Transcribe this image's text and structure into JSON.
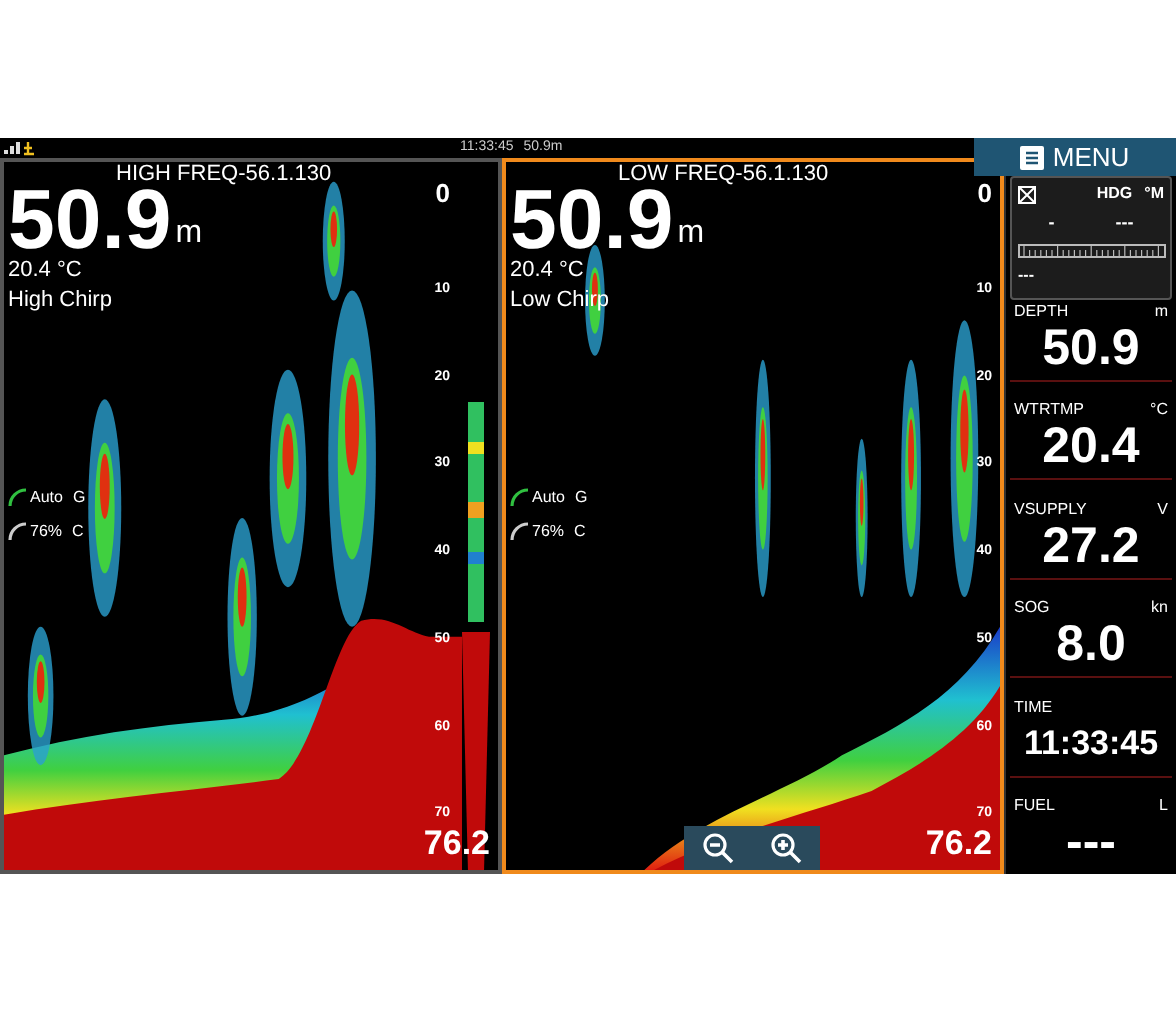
{
  "status_bar": {
    "time": "11:33:45",
    "depth": "50.9m"
  },
  "menu_button": {
    "label": "MENU"
  },
  "panels": [
    {
      "selected": false,
      "title": "HIGH FREQ-56.1.130",
      "depth": "50.9",
      "depth_unit": "m",
      "temperature": "20.4 °C",
      "mode": "High Chirp",
      "gain": {
        "value": "Auto",
        "letter": "G"
      },
      "color": {
        "value": "76%",
        "letter": "C"
      },
      "ticks": [
        "0",
        "10",
        "20",
        "30",
        "40",
        "50",
        "60",
        "70"
      ],
      "range_end": "76.2",
      "a_scope": true,
      "zoom_controls": false
    },
    {
      "selected": true,
      "title": "LOW FREQ-56.1.130",
      "depth": "50.9",
      "depth_unit": "m",
      "temperature": "20.4 °C",
      "mode": "Low Chirp",
      "gain": {
        "value": "Auto",
        "letter": "G"
      },
      "color": {
        "value": "76%",
        "letter": "C"
      },
      "ticks": [
        "0",
        "10",
        "20",
        "30",
        "40",
        "50",
        "60",
        "70"
      ],
      "range_end": "76.2",
      "a_scope": false,
      "zoom_controls": true
    }
  ],
  "compass": {
    "label": "HDG",
    "unit": "°M",
    "value_left": "-",
    "value_right": "---",
    "bottom": "---"
  },
  "gauges": [
    {
      "label": "DEPTH",
      "unit": "m",
      "value": "50.9"
    },
    {
      "label": "WTRTMP",
      "unit": "°C",
      "value": "20.4"
    },
    {
      "label": "VSUPPLY",
      "unit": "V",
      "value": "27.2"
    },
    {
      "label": "SOG",
      "unit": "kn",
      "value": "8.0"
    },
    {
      "label": "TIME",
      "value": "11:33:45"
    },
    {
      "label": "FUEL",
      "unit": "L",
      "value": "---"
    }
  ]
}
